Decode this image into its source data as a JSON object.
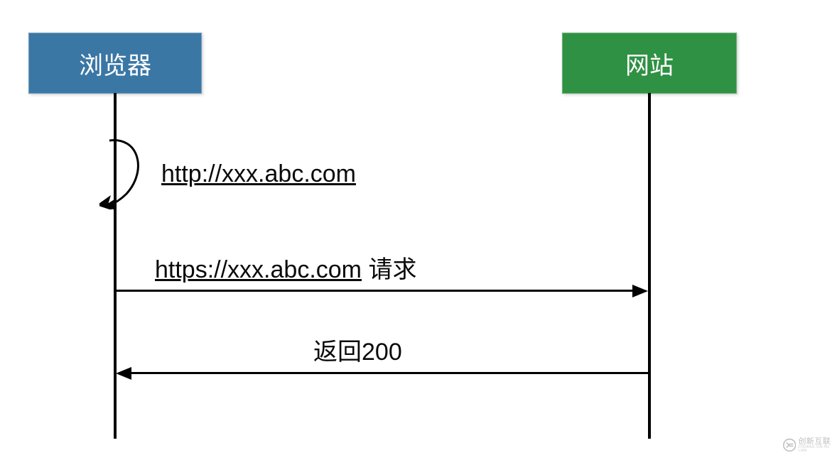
{
  "diagram": {
    "type": "sequence",
    "participants": {
      "left": {
        "label": "浏览器",
        "color": "#3a77a5"
      },
      "right": {
        "label": "网站",
        "color": "#2f9143"
      }
    },
    "messages": {
      "self_loop": {
        "from": "browser",
        "to": "browser",
        "url": "http://xxx.abc.com"
      },
      "request": {
        "from": "browser",
        "to": "website",
        "url": "https://xxx.abc.com",
        "suffix": " 请求"
      },
      "response": {
        "from": "website",
        "to": "browser",
        "text": "返回200"
      }
    }
  },
  "watermark": {
    "brand": "创新互联",
    "sub": "CHUANG XIN HU LIAN"
  }
}
